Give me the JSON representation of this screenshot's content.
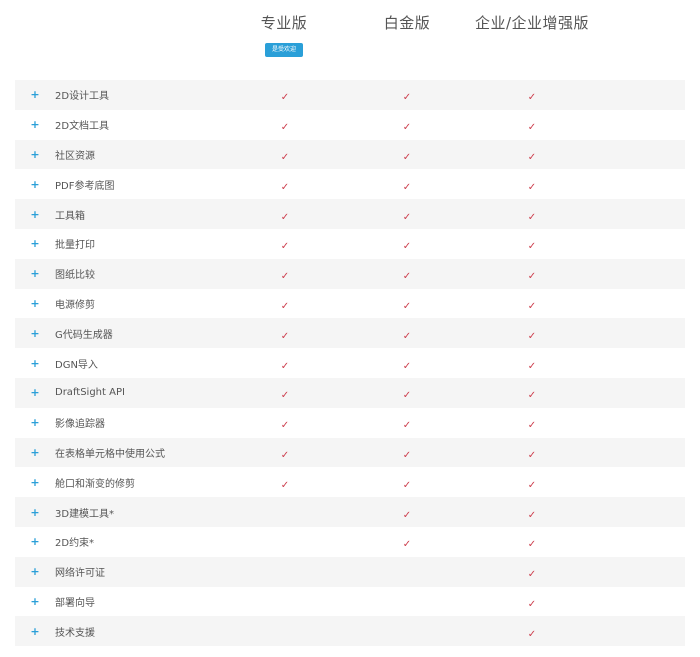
{
  "plans": [
    {
      "name": "专业版",
      "badge": "是受欢迎"
    },
    {
      "name": "白金版"
    },
    {
      "name": "企业/企业增强版"
    }
  ],
  "expand_symbol": "+",
  "check_symbol": "✓",
  "check_color": "#cc3d4c",
  "accent_color": "#2a9fd8",
  "features": [
    {
      "name": "2D设计工具",
      "pro": true,
      "platinum": true,
      "enterprise": true
    },
    {
      "name": "2D文档工具",
      "pro": true,
      "platinum": true,
      "enterprise": true
    },
    {
      "name": "社区资源",
      "pro": true,
      "platinum": true,
      "enterprise": true
    },
    {
      "name": "PDF参考底图",
      "pro": true,
      "platinum": true,
      "enterprise": true
    },
    {
      "name": "工具箱",
      "pro": true,
      "platinum": true,
      "enterprise": true
    },
    {
      "name": "批量打印",
      "pro": true,
      "platinum": true,
      "enterprise": true
    },
    {
      "name": "图纸比较",
      "pro": true,
      "platinum": true,
      "enterprise": true
    },
    {
      "name": "电源修剪",
      "pro": true,
      "platinum": true,
      "enterprise": true
    },
    {
      "name": "G代码生成器",
      "pro": true,
      "platinum": true,
      "enterprise": true
    },
    {
      "name": "DGN导入",
      "pro": true,
      "platinum": true,
      "enterprise": true
    },
    {
      "name": "DraftSight API",
      "pro": true,
      "platinum": true,
      "enterprise": true
    },
    {
      "name": "影像追踪器",
      "pro": true,
      "platinum": true,
      "enterprise": true
    },
    {
      "name": "在表格单元格中使用公式",
      "pro": true,
      "platinum": true,
      "enterprise": true
    },
    {
      "name": "舱口和渐变的修剪",
      "pro": true,
      "platinum": true,
      "enterprise": true
    },
    {
      "name": "3D建模工具*",
      "pro": false,
      "platinum": true,
      "enterprise": true
    },
    {
      "name": "2D约束*",
      "pro": false,
      "platinum": true,
      "enterprise": true
    },
    {
      "name": "网络许可证",
      "pro": false,
      "platinum": false,
      "enterprise": true
    },
    {
      "name": "部署向导",
      "pro": false,
      "platinum": false,
      "enterprise": true
    },
    {
      "name": "技术支援",
      "pro": false,
      "platinum": false,
      "enterprise": true
    }
  ]
}
